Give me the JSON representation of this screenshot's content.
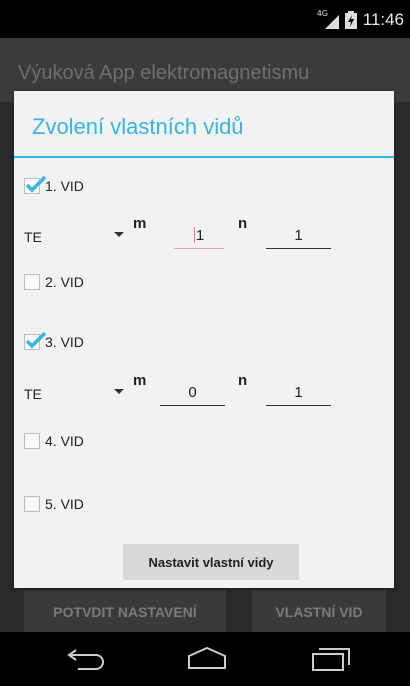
{
  "status_bar": {
    "time": "11:46",
    "network": "4G"
  },
  "app": {
    "title": "Výuková App elektromagnetismu",
    "bottom_buttons": {
      "confirm": "POTVDIT NASTAVENÍ",
      "custom_mode": "VLASTNÍ VID"
    }
  },
  "dialog": {
    "title": "Zvolení vlastních vidů",
    "modes": [
      {
        "label": "1. VID",
        "checked": true
      },
      {
        "label": "2. VID",
        "checked": false
      },
      {
        "label": "3. VID",
        "checked": true
      },
      {
        "label": "4. VID",
        "checked": false
      },
      {
        "label": "5. VID",
        "checked": false
      }
    ],
    "mode_params": [
      {
        "type": "TE",
        "m_label": "m",
        "m_value": "1",
        "n_label": "n",
        "n_value": "1"
      },
      {
        "type": "TE",
        "m_label": "m",
        "m_value": "0",
        "n_label": "n",
        "n_value": "1"
      }
    ],
    "submit_label": "Nastavit vlastní vidy"
  },
  "colors": {
    "accent": "#33b5e5",
    "dialog_bg": "#f2f2f2",
    "focus_underline": "#e6a3a8"
  },
  "nav": {
    "icons": [
      "back-icon",
      "home-icon",
      "recents-icon"
    ]
  }
}
